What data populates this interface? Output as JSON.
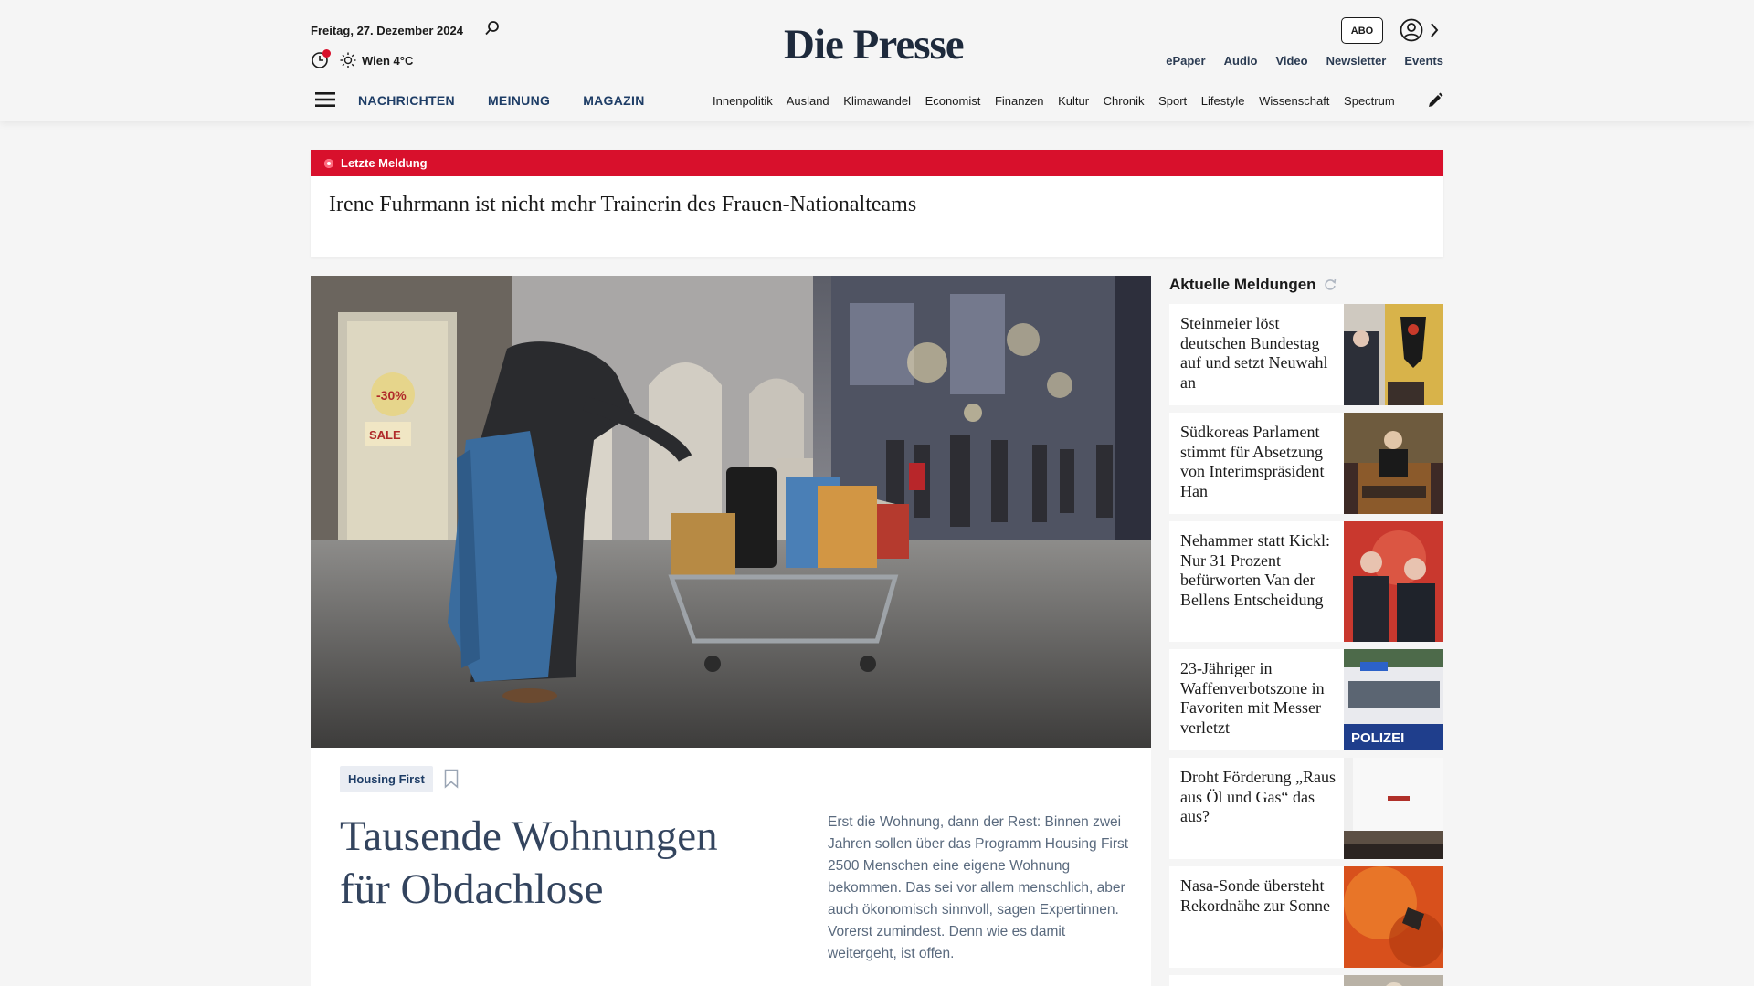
{
  "header": {
    "date": "Freitag, 27. Dezember 2024",
    "weather": "Wien 4°C",
    "logo": "Die Presse",
    "abo_label": "ABO",
    "top_links": [
      "ePaper",
      "Audio",
      "Video",
      "Newsletter",
      "Events"
    ],
    "main_nav": [
      "NACHRICHTEN",
      "MEINUNG",
      "MAGAZIN"
    ],
    "categories": [
      "Innenpolitik",
      "Ausland",
      "Klimawandel",
      "Economist",
      "Finanzen",
      "Kultur",
      "Chronik",
      "Sport",
      "Lifestyle",
      "Wissenschaft",
      "Spectrum"
    ]
  },
  "breaking": {
    "label": "Letzte Meldung",
    "title": "Irene Fuhrmann ist nicht mehr Trainerin des Frauen-Nationalteams"
  },
  "hero": {
    "tag": "Housing First",
    "title": "Tausende Wohnungen für Obdachlose",
    "teaser": "Erst die Wohnung, dann der Rest: Binnen zwei Jahren sollen über das Programm Housing First 2500 Menschen eine eigene Wohnung bekommen. Das sei vor allem menschlich, aber auch ökonomisch sinnvoll, sagen Expertinnen. Vorerst zumindest. Denn wie es damit weitergeht, ist offen.",
    "image_texts": [
      "SALE",
      "-30%",
      "POLIZEI"
    ]
  },
  "sidebar": {
    "heading": "Aktuelle Meldungen",
    "items": [
      {
        "title": "Steinmeier löst deutschen Bundestag auf und setzt Neuwahl an"
      },
      {
        "title": "Südkoreas Parlament stimmt für Absetzung von Interimspräsident Han"
      },
      {
        "title": "Nehammer statt Kickl: Nur 31 Prozent befürworten Van der Bellens Entscheidung"
      },
      {
        "title": "23-Jähriger in Waffenverbotszone in Favoriten mit Messer verletzt"
      },
      {
        "title": "Droht Förderung „Raus aus Öl und Gas“ das aus?"
      },
      {
        "title": "Nasa-Sonde übersteht Rekordnähe zur Sonne"
      }
    ]
  },
  "colors": {
    "accent_red": "#d8102c",
    "nav_blue": "#1e3d66",
    "headline_blue": "#33445e"
  }
}
